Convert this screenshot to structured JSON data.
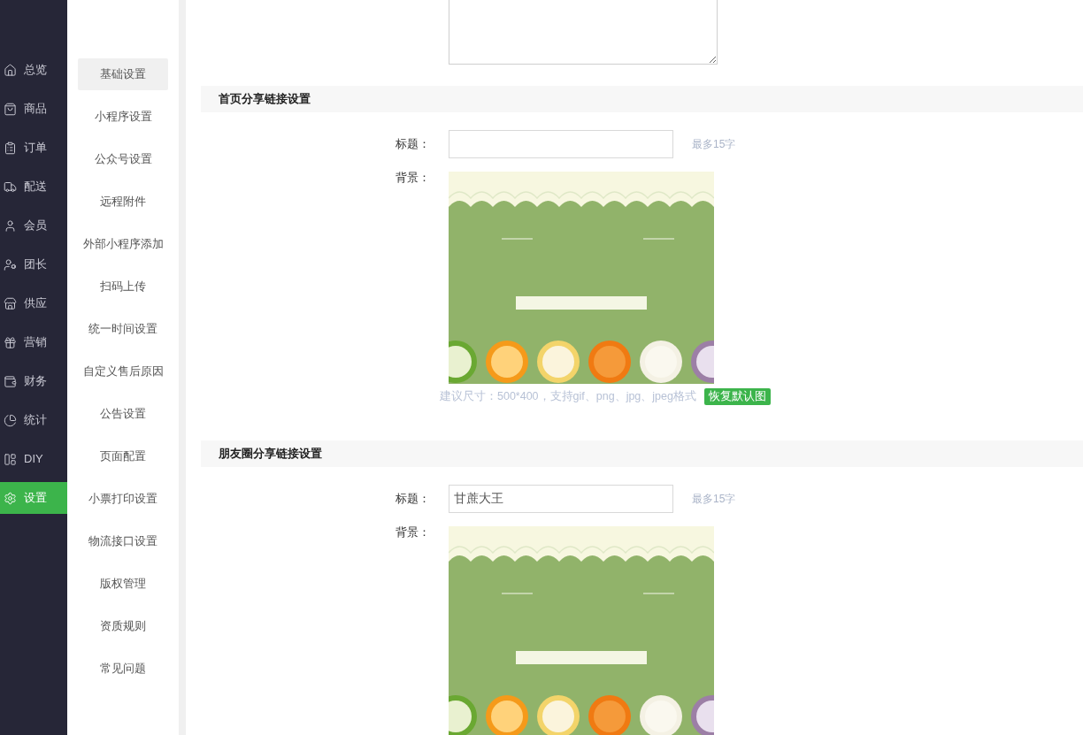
{
  "nav": [
    {
      "label": "总览",
      "selected": false
    },
    {
      "label": "商品",
      "selected": false
    },
    {
      "label": "订单",
      "selected": false
    },
    {
      "label": "配送",
      "selected": false
    },
    {
      "label": "会员",
      "selected": false
    },
    {
      "label": "团长",
      "selected": false
    },
    {
      "label": "供应",
      "selected": false
    },
    {
      "label": "营销",
      "selected": false
    },
    {
      "label": "财务",
      "selected": false
    },
    {
      "label": "统计",
      "selected": false
    },
    {
      "label": "DIY",
      "selected": false
    },
    {
      "label": "设置",
      "selected": true
    }
  ],
  "submenu": [
    {
      "label": "基础设置",
      "selected": true
    },
    {
      "label": "小程序设置",
      "selected": false
    },
    {
      "label": "公众号设置",
      "selected": false
    },
    {
      "label": "远程附件",
      "selected": false
    },
    {
      "label": "外部小程序添加",
      "selected": false
    },
    {
      "label": "扫码上传",
      "selected": false
    },
    {
      "label": "统一时间设置",
      "selected": false
    },
    {
      "label": "自定义售后原因",
      "selected": false
    },
    {
      "label": "公告设置",
      "selected": false
    },
    {
      "label": "页面配置",
      "selected": false
    },
    {
      "label": "小票打印设置",
      "selected": false
    },
    {
      "label": "物流接口设置",
      "selected": false
    },
    {
      "label": "版权管理",
      "selected": false
    },
    {
      "label": "资质规则",
      "selected": false
    },
    {
      "label": "常见问题",
      "selected": false
    }
  ],
  "sections": [
    {
      "title": "首页分享链接设置",
      "title_label": "标题：",
      "title_hint": "最多15字",
      "background_label": "背景：",
      "size_hint": "建议尺寸：500*400，支持gif、png、jpg、jpeg格式",
      "restore_button": "恢复默认图"
    },
    {
      "title": "朋友圈分享链接设置",
      "title_label": "标题：",
      "title_value": "甘蔗大王",
      "title_hint": "最多15字",
      "background_label": "背景："
    }
  ]
}
